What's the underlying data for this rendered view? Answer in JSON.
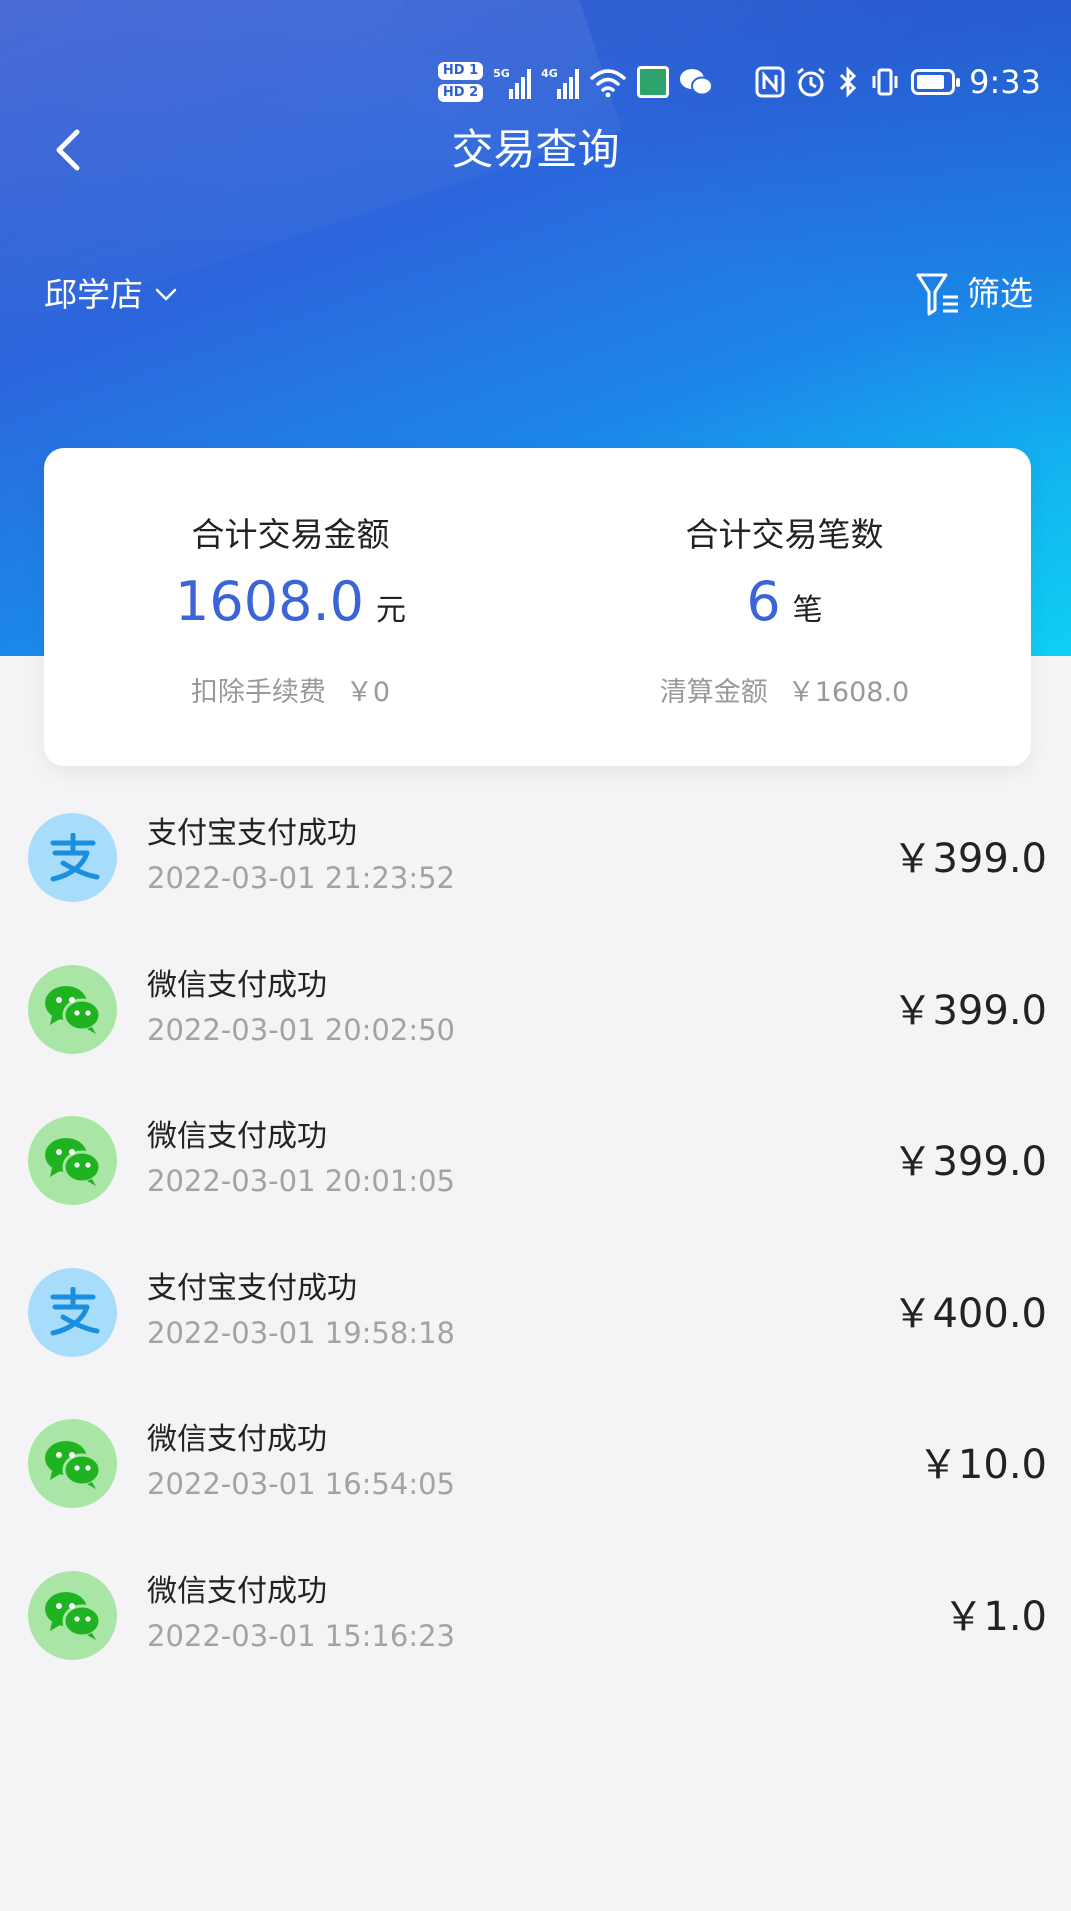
{
  "status_bar": {
    "hd1": "HD 1",
    "hd2": "HD 2",
    "net1": "5G",
    "net2": "4G",
    "battery_level": 0.85,
    "time": "9:33"
  },
  "header": {
    "title": "交易查询"
  },
  "store": {
    "name": "邱学店"
  },
  "filter": {
    "label": "筛选"
  },
  "summary": {
    "total_amount_label": "合计交易金额",
    "total_amount": "1608.0",
    "total_amount_unit": "元",
    "fee_label": "扣除手续费",
    "fee_amount": "￥0",
    "total_count_label": "合计交易笔数",
    "total_count": "6",
    "total_count_unit": "笔",
    "settle_label": "清算金额",
    "settle_amount": "￥1608.0"
  },
  "transactions": [
    {
      "type": "alipay",
      "icon": "alipay-icon",
      "title": "支付宝支付成功",
      "time": "2022-03-01 21:23:52",
      "amount": "￥399.0"
    },
    {
      "type": "wechat",
      "icon": "wechat-pay-icon",
      "title": "微信支付成功",
      "time": "2022-03-01 20:02:50",
      "amount": "￥399.0"
    },
    {
      "type": "wechat",
      "icon": "wechat-pay-icon",
      "title": "微信支付成功",
      "time": "2022-03-01 20:01:05",
      "amount": "￥399.0"
    },
    {
      "type": "alipay",
      "icon": "alipay-icon",
      "title": "支付宝支付成功",
      "time": "2022-03-01 19:58:18",
      "amount": "￥400.0"
    },
    {
      "type": "wechat",
      "icon": "wechat-pay-icon",
      "title": "微信支付成功",
      "time": "2022-03-01 16:54:05",
      "amount": "￥10.0"
    },
    {
      "type": "wechat",
      "icon": "wechat-pay-icon",
      "title": "微信支付成功",
      "time": "2022-03-01 15:16:23",
      "amount": "￥1.0"
    }
  ],
  "colors": {
    "accent": "#3a64d8",
    "alipay_bg": "#a7dcfa",
    "alipay_fg": "#1a8fe0",
    "wechat_bg": "#a9e5a5",
    "wechat_fg": "#1fb322"
  }
}
